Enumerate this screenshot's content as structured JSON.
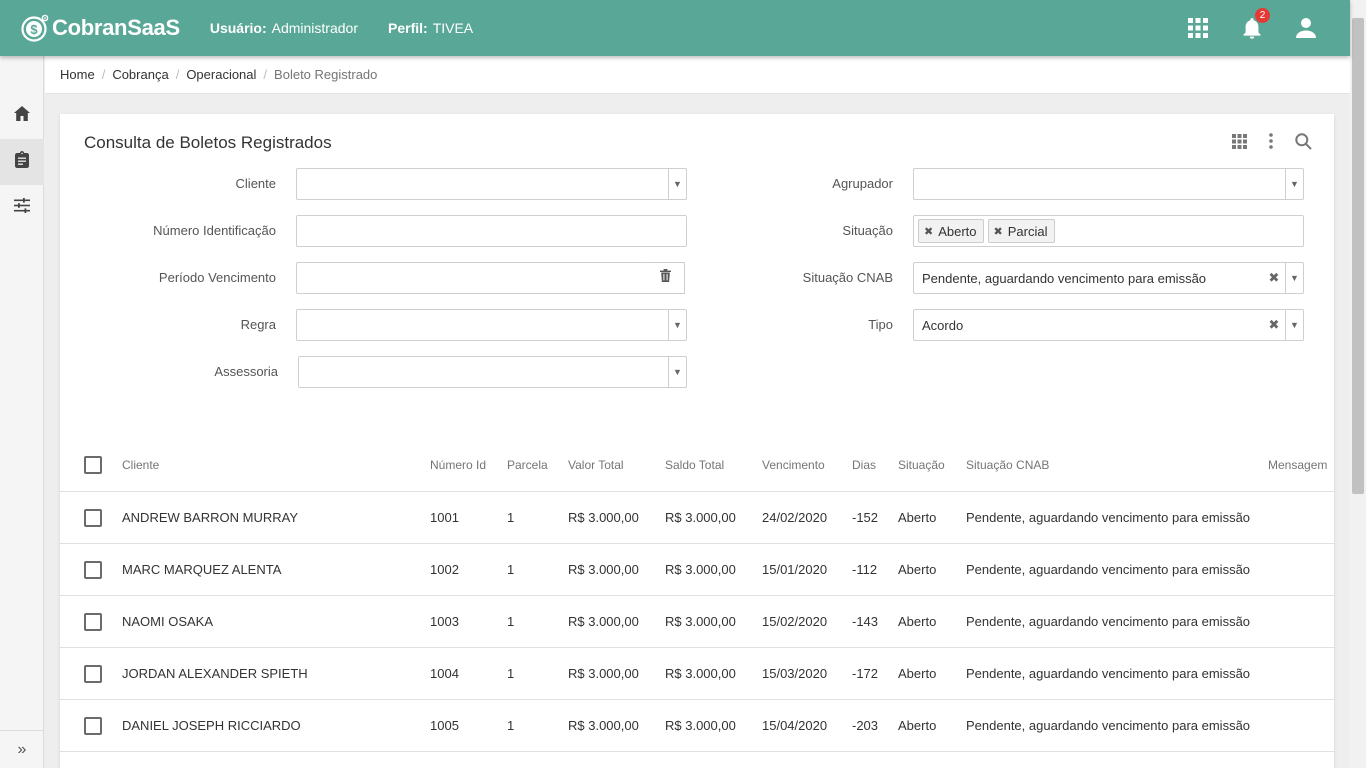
{
  "header": {
    "app_name": "CobranSaaS",
    "user_label": "Usuário:",
    "user_value": "Administrador",
    "profile_label": "Perfil:",
    "profile_value": "TIVEA",
    "notification_count": "2",
    "icons": [
      "apps-grid-icon",
      "bell-icon",
      "account-icon"
    ]
  },
  "sidebar": {
    "items": [
      {
        "icon": "home-icon"
      },
      {
        "icon": "clipboard-icon",
        "active": true
      },
      {
        "icon": "tune-sliders-icon"
      }
    ],
    "expand_glyph": "»"
  },
  "breadcrumb": {
    "items": [
      "Home",
      "Cobrança",
      "Operacional"
    ],
    "current": "Boleto Registrado"
  },
  "page": {
    "title": "Consulta de Boletos Registrados"
  },
  "filters": {
    "cliente": {
      "label": "Cliente",
      "value": ""
    },
    "numero_identificacao": {
      "label": "Número Identificação",
      "value": ""
    },
    "periodo_vencimento": {
      "label": "Período Vencimento",
      "value": ""
    },
    "regra": {
      "label": "Regra",
      "value": ""
    },
    "assessoria": {
      "label": "Assessoria",
      "value": ""
    },
    "agrupador": {
      "label": "Agrupador",
      "value": ""
    },
    "situacao": {
      "label": "Situação",
      "chips": [
        "Aberto",
        "Parcial"
      ]
    },
    "situacao_cnab": {
      "label": "Situação CNAB",
      "value": "Pendente, aguardando vencimento para emissão"
    },
    "tipo": {
      "label": "Tipo",
      "value": "Acordo"
    }
  },
  "table": {
    "columns": [
      "Cliente",
      "Número Id",
      "Parcela",
      "Valor Total",
      "Saldo Total",
      "Vencimento",
      "Dias",
      "Situação",
      "Situação CNAB",
      "Mensagem"
    ],
    "rows": [
      {
        "cliente": "ANDREW BARRON MURRAY",
        "numero_id": "1001",
        "parcela": "1",
        "valor_total": "R$ 3.000,00",
        "saldo_total": "R$ 3.000,00",
        "vencimento": "24/02/2020",
        "dias": "-152",
        "situacao": "Aberto",
        "situacao_cnab": "Pendente, aguardando vencimento para emissão",
        "mensagem": ""
      },
      {
        "cliente": "MARC MARQUEZ ALENTA",
        "numero_id": "1002",
        "parcela": "1",
        "valor_total": "R$ 3.000,00",
        "saldo_total": "R$ 3.000,00",
        "vencimento": "15/01/2020",
        "dias": "-112",
        "situacao": "Aberto",
        "situacao_cnab": "Pendente, aguardando vencimento para emissão",
        "mensagem": ""
      },
      {
        "cliente": "NAOMI OSAKA",
        "numero_id": "1003",
        "parcela": "1",
        "valor_total": "R$ 3.000,00",
        "saldo_total": "R$ 3.000,00",
        "vencimento": "15/02/2020",
        "dias": "-143",
        "situacao": "Aberto",
        "situacao_cnab": "Pendente, aguardando vencimento para emissão",
        "mensagem": ""
      },
      {
        "cliente": "JORDAN ALEXANDER SPIETH",
        "numero_id": "1004",
        "parcela": "1",
        "valor_total": "R$ 3.000,00",
        "saldo_total": "R$ 3.000,00",
        "vencimento": "15/03/2020",
        "dias": "-172",
        "situacao": "Aberto",
        "situacao_cnab": "Pendente, aguardando vencimento para emissão",
        "mensagem": ""
      },
      {
        "cliente": "DANIEL JOSEPH RICCIARDO",
        "numero_id": "1005",
        "parcela": "1",
        "valor_total": "R$ 3.000,00",
        "saldo_total": "R$ 3.000,00",
        "vencimento": "15/04/2020",
        "dias": "-203",
        "situacao": "Aberto",
        "situacao_cnab": "Pendente, aguardando vencimento para emissão",
        "mensagem": ""
      }
    ]
  },
  "colors": {
    "header_bg": "#59a897",
    "badge": "#e53935"
  }
}
